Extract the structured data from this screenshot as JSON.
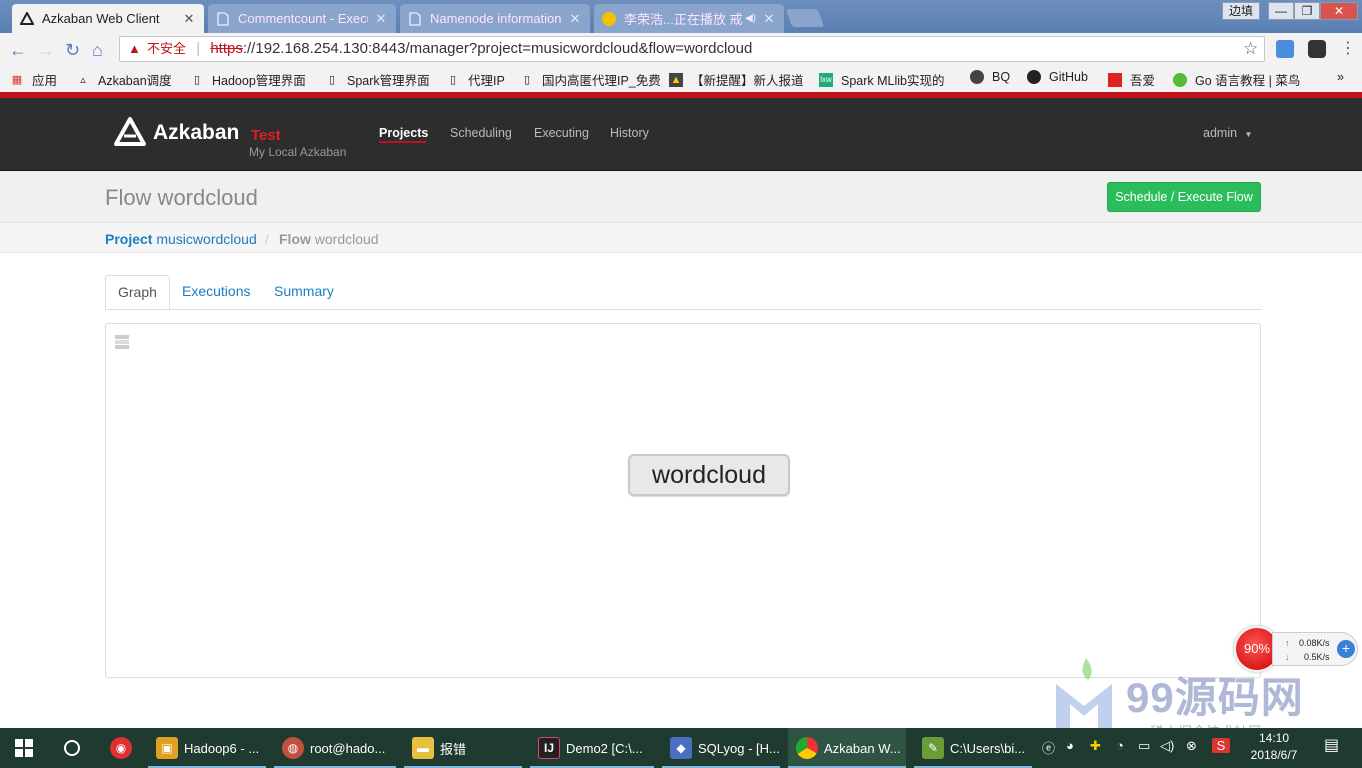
{
  "browser": {
    "tabs": [
      {
        "title": "Azkaban Web Client",
        "active": true
      },
      {
        "title": "Commentcount - Execu",
        "active": false
      },
      {
        "title": "Namenode information",
        "active": false
      },
      {
        "title": "李荣浩...正在播放 戒",
        "active": false
      }
    ],
    "window_buttons": {
      "ime": "边填",
      "minimize": "—",
      "restore": "❐",
      "close": "✕"
    },
    "security_label": "不安全",
    "url_scheme": "https",
    "url_rest": "://192.168.254.130:8443/manager?project=musicwordcloud&flow=wordcloud",
    "bookmarks": [
      "应用",
      "Azkaban调度",
      "Hadoop管理界面",
      "Spark管理界面",
      "代理IP",
      "国内高匿代理IP_免费",
      "【新提醒】新人报道",
      "Spark MLlib实现的",
      "BQ",
      "GitHub",
      "吾爱",
      "Go 语言教程 | 菜鸟"
    ]
  },
  "app": {
    "brand": "Azkaban",
    "env": "Test",
    "subtitle": "My Local Azkaban",
    "nav": [
      "Projects",
      "Scheduling",
      "Executing",
      "History"
    ],
    "user": "admin"
  },
  "page": {
    "title": "Flow wordcloud",
    "schedule_button": "Schedule / Execute Flow",
    "breadcrumb": {
      "project_label": "Project",
      "project_name": "musicwordcloud",
      "separator": "/",
      "flow_label": "Flow",
      "flow_name": "wordcloud"
    },
    "tabs": [
      "Graph",
      "Executions",
      "Summary"
    ],
    "graph_node": "wordcloud"
  },
  "overlay": {
    "percent": "90%",
    "upload": "0.08K/s",
    "download": "0.5K/s",
    "watermark": "99源码网",
    "watermark_sub": "稀土掘金技术社区"
  },
  "taskbar": {
    "apps": [
      "Hadoop6 - ...",
      "root@hado...",
      "报错",
      "Demo2 [C:\\...",
      "SQLyog - [H...",
      "Azkaban W...",
      "C:\\Users\\bi..."
    ],
    "time": "14:10",
    "date": "2018/6/7"
  },
  "colors": {
    "accent_red": "#c0121d",
    "navbar": "#2d2d2d",
    "link_blue": "#1b7ec2",
    "button_green": "#2bbd5d"
  }
}
